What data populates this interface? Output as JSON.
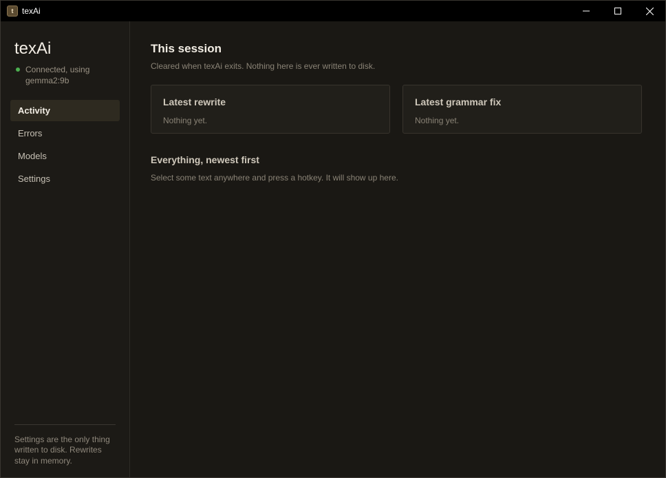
{
  "window": {
    "title": "texAi",
    "app_icon_glyph": "t",
    "controls": {
      "minimize": "minimize-icon",
      "maximize": "maximize-icon",
      "close": "close-icon"
    }
  },
  "sidebar": {
    "brand": "texAi",
    "status": {
      "text": "Connected, using gemma2:9b",
      "color": "#4caf50"
    },
    "items": [
      {
        "label": "Activity",
        "active": true
      },
      {
        "label": "Errors",
        "active": false
      },
      {
        "label": "Models",
        "active": false
      },
      {
        "label": "Settings",
        "active": false
      }
    ],
    "footer_note": "Settings are the only thing written to disk. Rewrites stay in memory."
  },
  "main": {
    "heading": "This session",
    "subheading": "Cleared when texAi exits. Nothing here is ever written to disk.",
    "cards": [
      {
        "title": "Latest rewrite",
        "body": "Nothing yet."
      },
      {
        "title": "Latest grammar fix",
        "body": "Nothing yet."
      }
    ],
    "history": {
      "heading": "Everything, newest first",
      "empty_text": "Select some text anywhere and press a hotkey. It will show up here."
    }
  },
  "colors": {
    "accent": "#2e2a20",
    "background": "#1a1814",
    "status_ok": "#4caf50"
  }
}
